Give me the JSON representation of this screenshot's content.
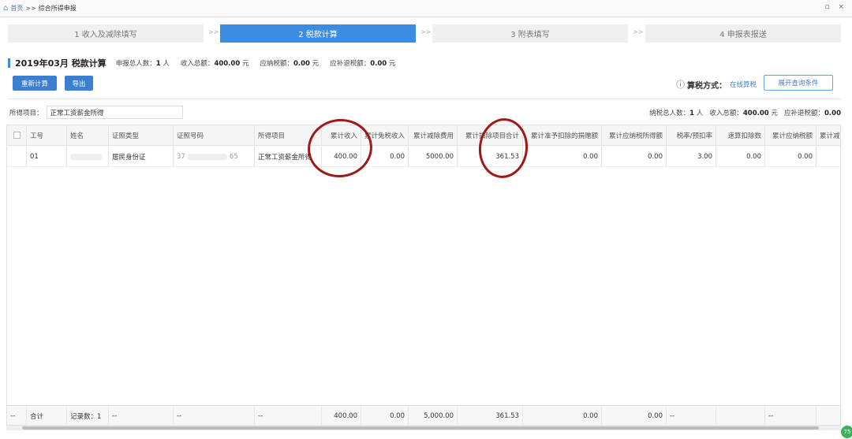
{
  "breadcrumb": {
    "home": "首页",
    "separator": ">>",
    "current": "综合所得申报"
  },
  "window_controls": "▫ ×",
  "steps": [
    "1 收入及减除填写",
    "2 税款计算",
    "3 附表填写",
    "4 申报表报送"
  ],
  "step_arrow": ">>",
  "active_step": 1,
  "header": {
    "title": "2019年03月 税款计算",
    "declarants": "申报总人数：",
    "declarants_val": "1",
    "declarants_unit": "人",
    "income": "收入总额：",
    "income_val": "400.00",
    "income_unit": "元",
    "tax_payable": "应纳税额：",
    "tax_payable_val": "0.00",
    "tax_payable_unit": "元",
    "refund": "应补退税额：",
    "refund_val": "0.00",
    "refund_unit": "元"
  },
  "buttons": {
    "recalc": "重新计算",
    "export": "导出",
    "expand": "展开查询条件"
  },
  "calc_mode": {
    "icon": "ⓘ",
    "label": "算税方式：",
    "value": "在线算税"
  },
  "income_item": {
    "label": "所得项目：",
    "value": "正常工资薪金所得"
  },
  "summary": {
    "taxpayers": "纳税总人数：",
    "taxpayers_val": "1",
    "taxpayers_unit": "人",
    "income": "收入总额：",
    "income_val": "400.00",
    "income_unit": "元",
    "refund": "应补退税额：",
    "refund_val": "0.00"
  },
  "table": {
    "headers": [
      "工号",
      "姓名",
      "证照类型",
      "证照号码",
      "所得项目",
      "累计收入",
      "累计免税收入",
      "累计减除费用",
      "累计扣除项目合计",
      "累计准予扣除的捐赠额",
      "累计应纳税所得额",
      "税率/预扣率",
      "速算扣除数",
      "累计应纳税额",
      "累计减免"
    ],
    "row": {
      "id": "01",
      "name": "",
      "id_type": "居民身份证",
      "id_num_prefix": "37",
      "id_num_suffix": "65",
      "item": "正常工资薪金所得",
      "income": "400.00",
      "exempt": "0.00",
      "deduction": "5000.00",
      "total_deduction": "361.53",
      "donation": "0.00",
      "taxable": "0.00",
      "rate": "3.00",
      "quick": "0.00",
      "tax": "0.00"
    },
    "footer": {
      "dash": "--",
      "total_label": "合计",
      "record_count": "记录数：1",
      "income": "400.00",
      "exempt": "0.00",
      "deduction": "5,000.00",
      "total_deduction": "361.53",
      "donation": "0.00",
      "taxable": "0.00"
    }
  },
  "status_badge": "75",
  "annotation_color": "#a01818",
  "accent_color": "#3c8ddf"
}
